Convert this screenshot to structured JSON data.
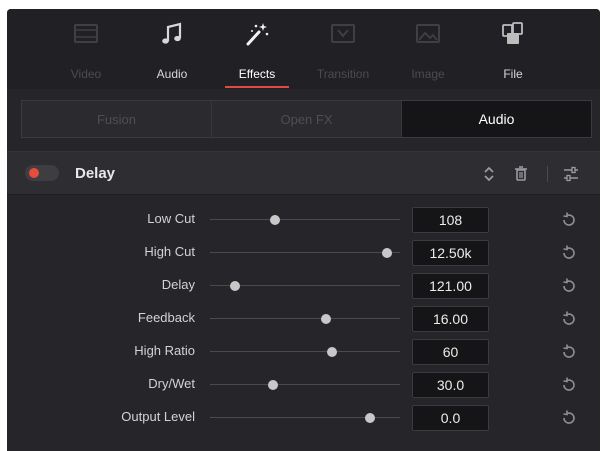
{
  "toolbar": {
    "items": [
      {
        "label": "Video",
        "icon": "video-icon",
        "state": "disabled"
      },
      {
        "label": "Audio",
        "icon": "music-note-icon",
        "state": "enabled"
      },
      {
        "label": "Effects",
        "icon": "magic-wand-icon",
        "state": "active"
      },
      {
        "label": "Transition",
        "icon": "transition-icon",
        "state": "disabled"
      },
      {
        "label": "Image",
        "icon": "image-icon",
        "state": "disabled"
      },
      {
        "label": "File",
        "icon": "file-icon",
        "state": "enabled"
      }
    ],
    "active_underline_color": "#e04a3f"
  },
  "subtabs": [
    {
      "label": "Fusion",
      "active": false
    },
    {
      "label": "Open FX",
      "active": false
    },
    {
      "label": "Audio",
      "active": true
    }
  ],
  "effect": {
    "title": "Delay",
    "enabled": true,
    "toggle_color": "#e84c3d",
    "header_icons": [
      "expand-collapse-icon",
      "trash-icon",
      "settings-sliders-icon"
    ]
  },
  "params": [
    {
      "label": "Low Cut",
      "value": "108",
      "slider": 0.34
    },
    {
      "label": "High Cut",
      "value": "12.50k",
      "slider": 0.93
    },
    {
      "label": "Delay",
      "value": "121.00",
      "slider": 0.13
    },
    {
      "label": "Feedback",
      "value": "16.00",
      "slider": 0.61
    },
    {
      "label": "High Ratio",
      "value": "60",
      "slider": 0.64
    },
    {
      "label": "Dry/Wet",
      "value": "30.0",
      "slider": 0.33
    },
    {
      "label": "Output Level",
      "value": "0.0",
      "slider": 0.84
    }
  ]
}
